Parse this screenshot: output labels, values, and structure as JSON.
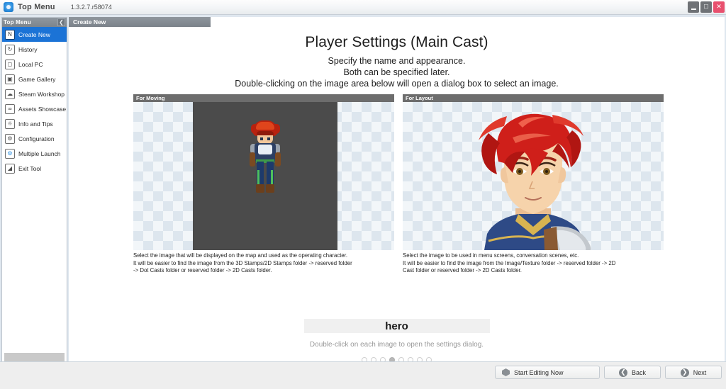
{
  "window": {
    "app_icon": "app-logo-icon",
    "title": "Top Menu",
    "version": "1.3.2.7.r58074",
    "minimize_label": "–",
    "maximize_label": "❐",
    "close_label": "✕"
  },
  "sidebar": {
    "header_label": "Top Menu",
    "collapse_label": "❮",
    "items": [
      {
        "label": "Create New",
        "icon": "new-document-icon",
        "active": true
      },
      {
        "label": "History",
        "icon": "clock-history-icon",
        "active": false
      },
      {
        "label": "Local PC",
        "icon": "desktop-pc-icon",
        "active": false
      },
      {
        "label": "Game Gallery",
        "icon": "gallery-image-icon",
        "active": false
      },
      {
        "label": "Steam Workshop",
        "icon": "cloud-icon",
        "active": false
      },
      {
        "label": "Assets Showcase",
        "icon": "link-chain-icon",
        "active": false
      },
      {
        "label": "Info and Tips",
        "icon": "lightbulb-icon",
        "active": false
      },
      {
        "label": "Configuration",
        "icon": "gear-icon",
        "active": false
      },
      {
        "label": "Multiple Launch",
        "icon": "multi-launch-icon",
        "active": false
      },
      {
        "label": "Exit Tool",
        "icon": "exit-door-icon",
        "active": false
      }
    ]
  },
  "tab": {
    "label": "Create New"
  },
  "main": {
    "title": "Player Settings (Main Cast)",
    "subtitle_line1": "Specify the name and appearance.",
    "subtitle_line2": "Both can be specified later.",
    "subtitle_line3": "Double-clicking on the image area below will open a dialog box to select an image.",
    "panels": [
      {
        "header": "For Moving",
        "image_alt": "pixel-art-character-sprite",
        "caption_line1": "Select the image that will be displayed on the map and used as the operating character.",
        "caption_line2": "It will be easier to find the image from the 3D Stamps/2D Stamps folder -> reserved folder",
        "caption_line3": "-> Dot Casts folder or reserved folder -> 2D Casts folder."
      },
      {
        "header": "For Layout",
        "image_alt": "anime-character-portrait",
        "caption_line1": "Select the image to be used in menu screens, conversation scenes, etc.",
        "caption_line2": "It will be easier to find the image from the Image/Texture folder -> reserved folder -> 2D",
        "caption_line3": "Cast folder or reserved folder -> 2D Casts folder."
      }
    ],
    "name_value": "hero",
    "name_placeholder": "hero",
    "hint": "Double-click on each image to open the settings dialog.",
    "pagination": {
      "total": 8,
      "active_index": 4
    }
  },
  "footer": {
    "start_editing_label": "Start Editing Now",
    "start_editing_icon": "cube-icon",
    "back_label": "Back",
    "back_icon": "arrow-left-circle-icon",
    "next_label": "Next",
    "next_icon": "arrow-right-circle-icon"
  },
  "colors": {
    "accent_blue": "#1b73d6",
    "panel_header_gray": "#6d6d6d",
    "close_red": "#e8506e",
    "hint_gray": "#9a9a9a"
  }
}
